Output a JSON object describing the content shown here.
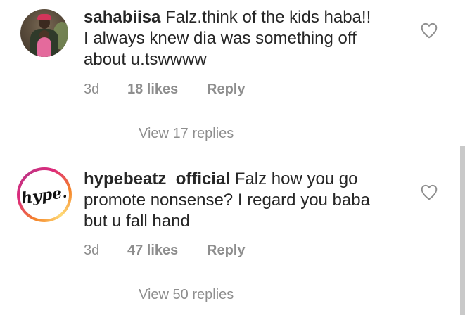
{
  "comments": [
    {
      "username": "sahabiisa",
      "text": "Falz.think of the kids haba!! I always knew dia was something off about u.tswwww",
      "lines": [
        "Falz.think of the kids haba!!",
        "I always knew dia was something off",
        "about u.tswwww"
      ],
      "age": "3d",
      "likes": "18 likes",
      "reply_label": "Reply",
      "view_replies": "View 17 replies",
      "avatar": "profile-photo"
    },
    {
      "username": "hypebeatz_official",
      "text": "Falz how you go promote nonsense? I regard you baba but u fall hand",
      "lines": [
        "Falz how you go",
        "promote nonsense? I regard you baba",
        "but u fall hand"
      ],
      "age": "3d",
      "likes": "47 likes",
      "reply_label": "Reply",
      "view_replies": "View 50 replies",
      "avatar": "hype-logo",
      "avatar_logo_text": "hype."
    }
  ],
  "icons": {
    "like": "heart-outline-icon"
  },
  "colors": {
    "text": "#262626",
    "secondary": "#8e8e8e",
    "divider": "#c7c7c7",
    "story_ring": [
      "#f58529",
      "#dd2a7b",
      "#c13584",
      "#feda77"
    ]
  }
}
